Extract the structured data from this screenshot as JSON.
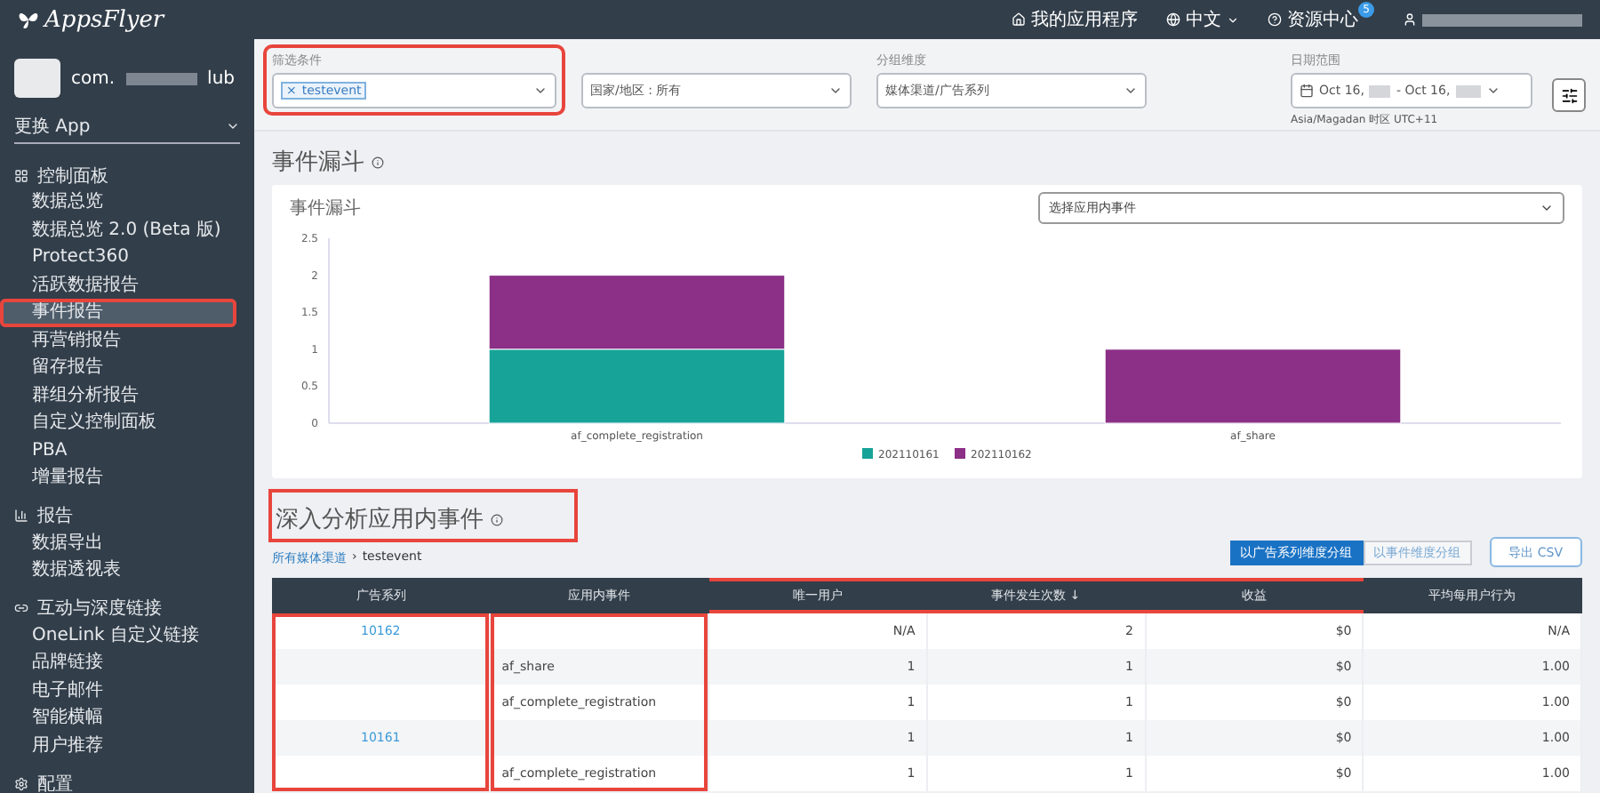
{
  "top_bar": {
    "logo": "AppsFlyer",
    "links": [
      {
        "kind": "home",
        "label": "我的应用程序",
        "dropdown": false
      },
      {
        "kind": "globe",
        "label": "中文",
        "dropdown": true
      },
      {
        "kind": "help",
        "label": "资源中心",
        "dropdown": false,
        "badge": "5"
      }
    ],
    "user": {
      "kind": "user"
    }
  },
  "sidebar": {
    "app_name_start": "com.",
    "app_name_end": "lub",
    "switch_app": "更换 App",
    "groups": [
      {
        "kind": "dashboard",
        "label": "控制面板",
        "items": [
          {
            "label": "数据总览",
            "selected": false,
            "highlighted": false
          },
          {
            "label": "数据总览 2.0 (Beta 版)",
            "selected": false,
            "highlighted": false
          },
          {
            "label": "Protect360",
            "selected": false,
            "highlighted": false
          },
          {
            "label": "活跃数据报告",
            "selected": false,
            "highlighted": false
          },
          {
            "label": "事件报告",
            "selected": true,
            "highlighted": true
          },
          {
            "label": "再营销报告",
            "selected": false,
            "highlighted": false
          },
          {
            "label": "留存报告",
            "selected": false,
            "highlighted": false
          },
          {
            "label": "群组分析报告",
            "selected": false,
            "highlighted": false
          },
          {
            "label": "自定义控制面板",
            "selected": false,
            "highlighted": false
          },
          {
            "label": "PBA",
            "selected": false,
            "highlighted": false
          },
          {
            "label": "增量报告",
            "selected": false,
            "highlighted": false
          }
        ]
      },
      {
        "kind": "report",
        "label": "报告",
        "items": [
          {
            "label": "数据导出",
            "selected": false,
            "highlighted": false
          },
          {
            "label": "数据透视表",
            "selected": false,
            "highlighted": false
          }
        ]
      },
      {
        "kind": "link",
        "label": "互动与深度链接",
        "items": [
          {
            "label": "OneLink 自定义链接",
            "selected": false,
            "highlighted": false
          },
          {
            "label": "品牌链接",
            "selected": false,
            "highlighted": false
          },
          {
            "label": "电子邮件",
            "selected": false,
            "highlighted": false
          },
          {
            "label": "智能横幅",
            "selected": false,
            "highlighted": false
          },
          {
            "label": "用户推荐",
            "selected": false,
            "highlighted": false
          }
        ]
      },
      {
        "kind": "gear",
        "label": "配置"
      }
    ]
  },
  "filters": [
    {
      "kind": "tags",
      "label": "筛选条件",
      "tags": [
        "testevent"
      ],
      "remove": "×",
      "highlighted": true
    },
    {
      "kind": "select",
      "value": "国家/地区 : 所有",
      "highlighted": false
    },
    {
      "kind": "select",
      "label": "分组维度",
      "value": "媒体渠道/广告系列",
      "highlighted": false
    },
    {
      "kind": "date",
      "label": "日期范围",
      "value_start": "Oct 16,",
      "value_end": "- Oct 16,",
      "note": "Asia/Magadan 时区 UTC+11",
      "highlighted": false
    }
  ],
  "funnel": {
    "title": "事件漏斗",
    "card_title": "事件漏斗",
    "event_select": {
      "placeholder": "选择应用内事件"
    },
    "chart_data": {
      "type": "bar",
      "stacked": true,
      "legend": "bottom",
      "categories": [
        "af_complete_registration",
        "af_share"
      ],
      "series": [
        {
          "name": "202110161",
          "color": "#17a398",
          "values": [
            1,
            null
          ]
        },
        {
          "name": "202110162",
          "color": "#8b2f87",
          "values": [
            1,
            1
          ]
        }
      ],
      "ylim": [
        0,
        2.5
      ],
      "yticks": [
        0,
        0.5,
        1,
        1.5,
        2,
        2.5
      ]
    }
  },
  "drilldown": {
    "title": "深入分析应用内事件",
    "title_highlighted": true,
    "breadcrumb": {
      "link": "所有媒体渠道",
      "separator": "›",
      "current": "testevent"
    },
    "group_tabs": [
      {
        "label": "以广告系列维度分组",
        "selected": true
      },
      {
        "label": "以事件维度分组",
        "selected": false
      }
    ],
    "export": "导出 CSV",
    "table": {
      "columns": [
        {
          "label": "广告系列",
          "header_highlighted": false,
          "cells_highlighted": true
        },
        {
          "label": "应用内事件",
          "header_highlighted": false,
          "cells_highlighted": true
        },
        {
          "label": "唯一用户",
          "header_highlighted": true,
          "cells_highlighted": false
        },
        {
          "label": "事件发生次数",
          "sort": "↓",
          "header_highlighted": true,
          "cells_highlighted": false
        },
        {
          "label": "收益",
          "header_highlighted": true,
          "cells_highlighted": false
        },
        {
          "label": "平均每用户行为",
          "header_highlighted": false,
          "cells_highlighted": false
        }
      ],
      "rows": [
        {
          "cells": [
            "10162",
            "",
            "N/A",
            "2",
            "$0",
            "N/A"
          ]
        },
        {
          "cells": [
            "",
            "af_share",
            "1",
            "1",
            "$0",
            "1.00"
          ]
        },
        {
          "cells": [
            "",
            "af_complete_registration",
            "1",
            "1",
            "$0",
            "1.00"
          ]
        },
        {
          "cells": [
            "10161",
            "",
            "1",
            "1",
            "$0",
            "1.00"
          ]
        },
        {
          "cells": [
            "",
            "af_complete_registration",
            "1",
            "1",
            "$0",
            "1.00"
          ]
        }
      ]
    }
  }
}
